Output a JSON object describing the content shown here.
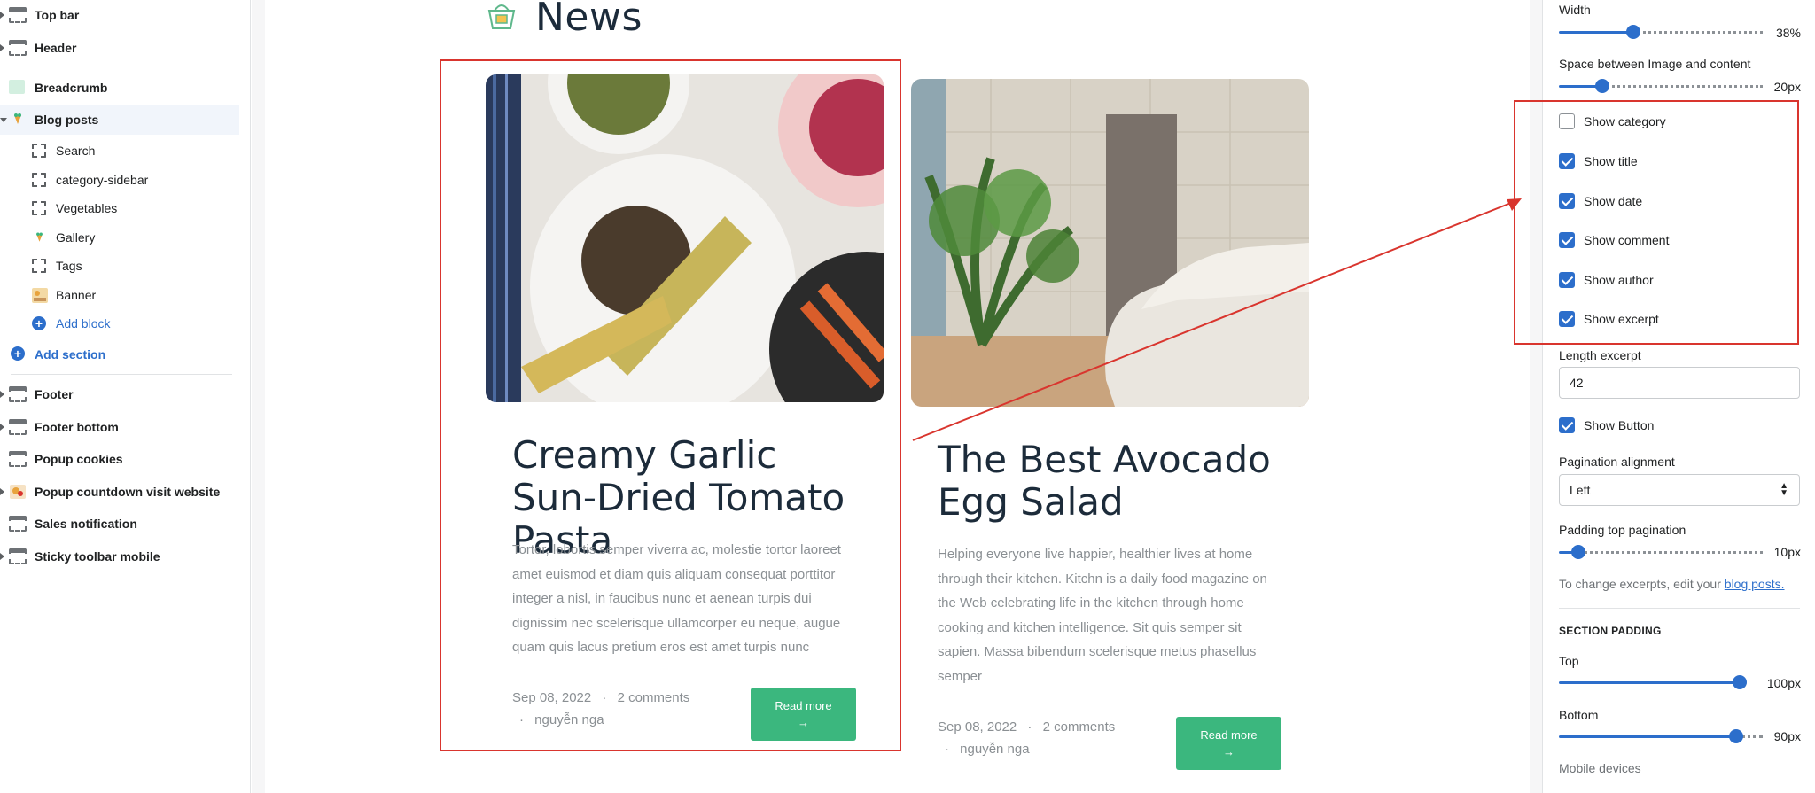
{
  "sidebar": {
    "sections_top": [
      {
        "label": "Top bar",
        "icon": "section-icon"
      },
      {
        "label": "Header",
        "icon": "section-icon"
      },
      {
        "label": "Breadcrumb",
        "icon": "image-icon"
      },
      {
        "label": "Blog posts",
        "icon": "app-block-icon"
      }
    ],
    "blocks": [
      {
        "label": "Search",
        "icon": "block-icon"
      },
      {
        "label": "category-sidebar",
        "icon": "block-icon"
      },
      {
        "label": "Vegetables",
        "icon": "block-icon"
      },
      {
        "label": "Gallery",
        "icon": "app-block-icon"
      },
      {
        "label": "Tags",
        "icon": "block-icon"
      },
      {
        "label": "Banner",
        "icon": "image-icon"
      }
    ],
    "add_block": "Add block",
    "add_section": "Add section",
    "sections_bottom": [
      {
        "label": "Footer",
        "icon": "section-icon"
      },
      {
        "label": "Footer bottom",
        "icon": "section-icon"
      },
      {
        "label": "Popup cookies",
        "icon": "section-icon"
      },
      {
        "label": "Popup countdown visit website",
        "icon": "image-icon"
      },
      {
        "label": "Sales notification",
        "icon": "section-icon"
      },
      {
        "label": "Sticky toolbar mobile",
        "icon": "section-icon"
      }
    ]
  },
  "preview": {
    "news_title": "News",
    "posts": [
      {
        "title": "Creamy Garlic Sun-Dried Tomato Pasta",
        "excerpt": "Tortor, lobortis semper viverra ac, molestie tortor laoreet amet euismod et diam quis aliquam consequat porttitor integer a nisl, in faucibus nunc et aenean turpis dui dignissim nec scelerisque ullamcorper eu neque, augue quam quis lacus pretium eros est amet turpis nunc",
        "date": "Sep 08, 2022",
        "comments": "2 comments",
        "author": "nguyễn nga",
        "button": "Read more",
        "button_arrow": "→"
      },
      {
        "title": "The Best Avocado Egg Salad",
        "excerpt": "Helping everyone live happier, healthier lives at home through their kitchen. Kitchn is a daily food magazine on the Web celebrating life in the kitchen through home cooking and kitchen intelligence. Sit quis semper sit sapien. Massa bibendum scelerisque metus phasellus semper",
        "date": "Sep 08, 2022",
        "comments": "2 comments",
        "author": "nguyễn nga",
        "button": "Read more",
        "button_arrow": "→"
      }
    ]
  },
  "panel": {
    "width": {
      "label": "Width",
      "value": "38%",
      "fraction": 0.38
    },
    "space": {
      "label": "Space between Image and content",
      "value": "20px",
      "fraction": 0.22
    },
    "checkboxes": [
      {
        "label": "Show category",
        "checked": false
      },
      {
        "label": "Show title",
        "checked": true
      },
      {
        "label": "Show date",
        "checked": true
      },
      {
        "label": "Show comment",
        "checked": true
      },
      {
        "label": "Show author",
        "checked": true
      },
      {
        "label": "Show excerpt",
        "checked": true
      }
    ],
    "length_excerpt": {
      "label": "Length excerpt",
      "value": "42"
    },
    "show_button": {
      "label": "Show Button",
      "checked": true
    },
    "pagination_alignment": {
      "label": "Pagination alignment",
      "value": "Left"
    },
    "padding_top_pagination": {
      "label": "Padding top pagination",
      "value": "10px",
      "fraction": 0.1
    },
    "help_text": "To change excerpts, edit your ",
    "help_link": "blog posts.",
    "section_padding": {
      "heading": "SECTION PADDING",
      "top": {
        "label": "Top",
        "value": "100px",
        "fraction": 1.0
      },
      "bottom": {
        "label": "Bottom",
        "value": "90px",
        "fraction": 0.9
      }
    },
    "mobile_devices": "Mobile devices"
  },
  "colors": {
    "accent": "#2c6ecb",
    "button_green": "#3bb77e",
    "annotation_red": "#d9352e",
    "heading_dark": "#1c2b3a"
  }
}
